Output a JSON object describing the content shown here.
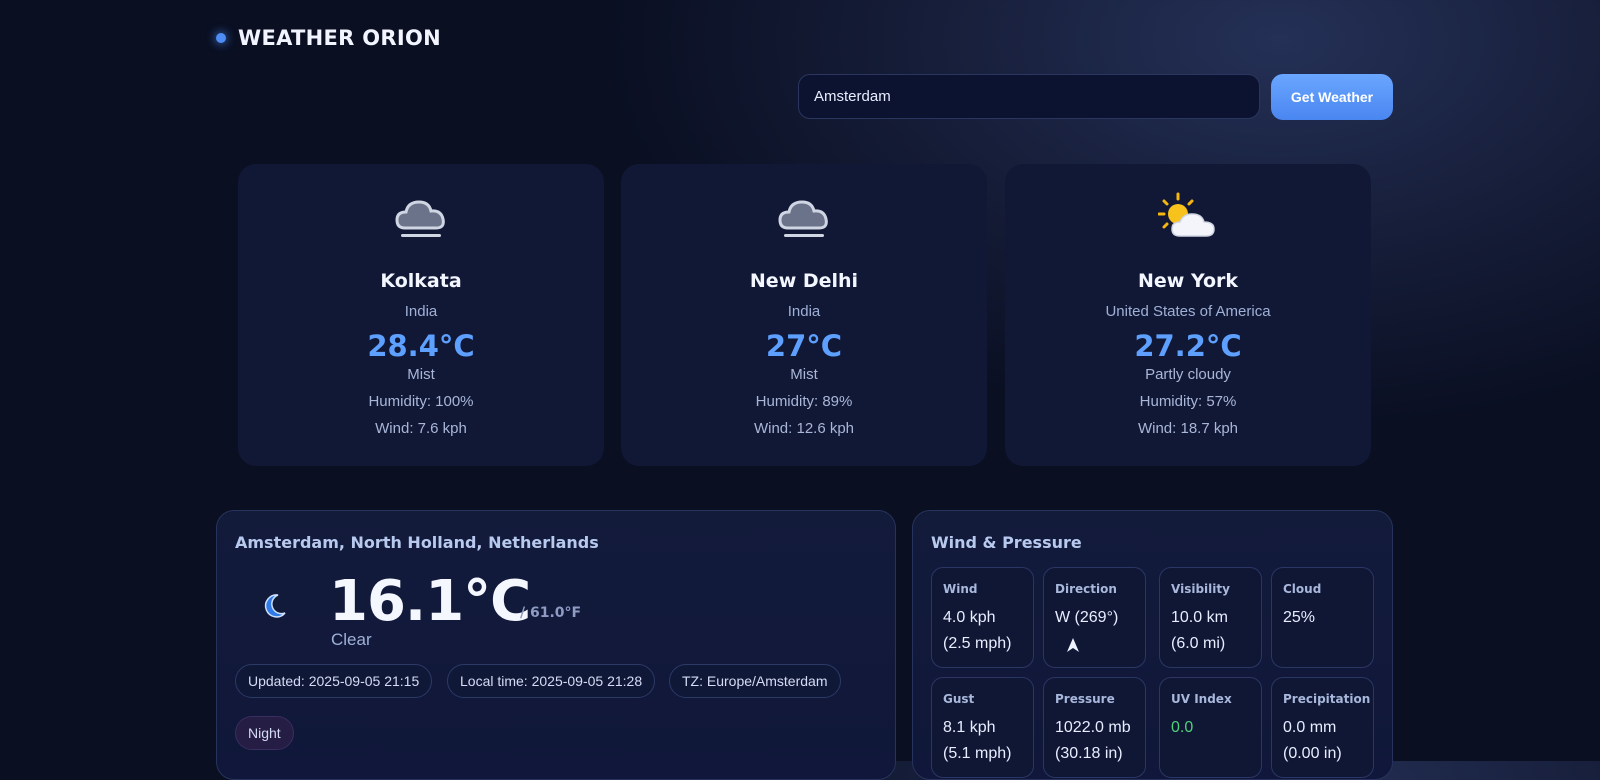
{
  "brand": {
    "title": "WEATHER ORION"
  },
  "search": {
    "value": "Amsterdam",
    "button_label": "Get Weather"
  },
  "cities": [
    {
      "name": "Kolkata",
      "country": "India",
      "temp": "28.4°C",
      "condition": "Mist",
      "humidity": "Humidity: 100%",
      "wind": "Wind: 7.6 kph",
      "icon": "mist-cloud-icon"
    },
    {
      "name": "New Delhi",
      "country": "India",
      "temp": "27°C",
      "condition": "Mist",
      "humidity": "Humidity: 89%",
      "wind": "Wind: 12.6 kph",
      "icon": "mist-cloud-icon"
    },
    {
      "name": "New York",
      "country": "United States of America",
      "temp": "27.2°C",
      "condition": "Partly cloudy",
      "humidity": "Humidity: 57%",
      "wind": "Wind: 18.7 kph",
      "icon": "partly-cloudy-icon"
    }
  ],
  "current": {
    "location": "Amsterdam, North Holland, Netherlands",
    "temp_c": "16.1°C",
    "temp_f": "/ 61.0°F",
    "condition": "Clear",
    "icon": "crescent-moon-icon",
    "updated": "Updated: 2025-09-05 21:15",
    "local_time": "Local time: 2025-09-05 21:28",
    "timezone": "TZ: Europe/Amsterdam",
    "day_night": "Night"
  },
  "wind_pressure": {
    "title": "Wind & Pressure",
    "stats": {
      "wind": {
        "label": "Wind",
        "v1": "4.0 kph",
        "v2": "(2.5 mph)"
      },
      "direction": {
        "label": "Direction",
        "v1": "W (269°)",
        "icon": "wind-arrow-icon"
      },
      "visibility": {
        "label": "Visibility",
        "v1": "10.0 km",
        "v2": "(6.0 mi)"
      },
      "cloud": {
        "label": "Cloud",
        "v1": "25%"
      },
      "gust": {
        "label": "Gust",
        "v1": "8.1 kph",
        "v2": "(5.1 mph)"
      },
      "pressure": {
        "label": "Pressure",
        "v1": "1022.0 mb",
        "v2": "(30.18 in)"
      },
      "uv": {
        "label": "UV Index",
        "v1": "0.0"
      },
      "precipitation": {
        "label": "Precipitation",
        "v1": "0.0 mm",
        "v2": "(0.00 in)"
      }
    }
  },
  "colors": {
    "accent": "#4d8df5",
    "temp": "#5ea0ff",
    "uv_good": "#4fd17a"
  }
}
